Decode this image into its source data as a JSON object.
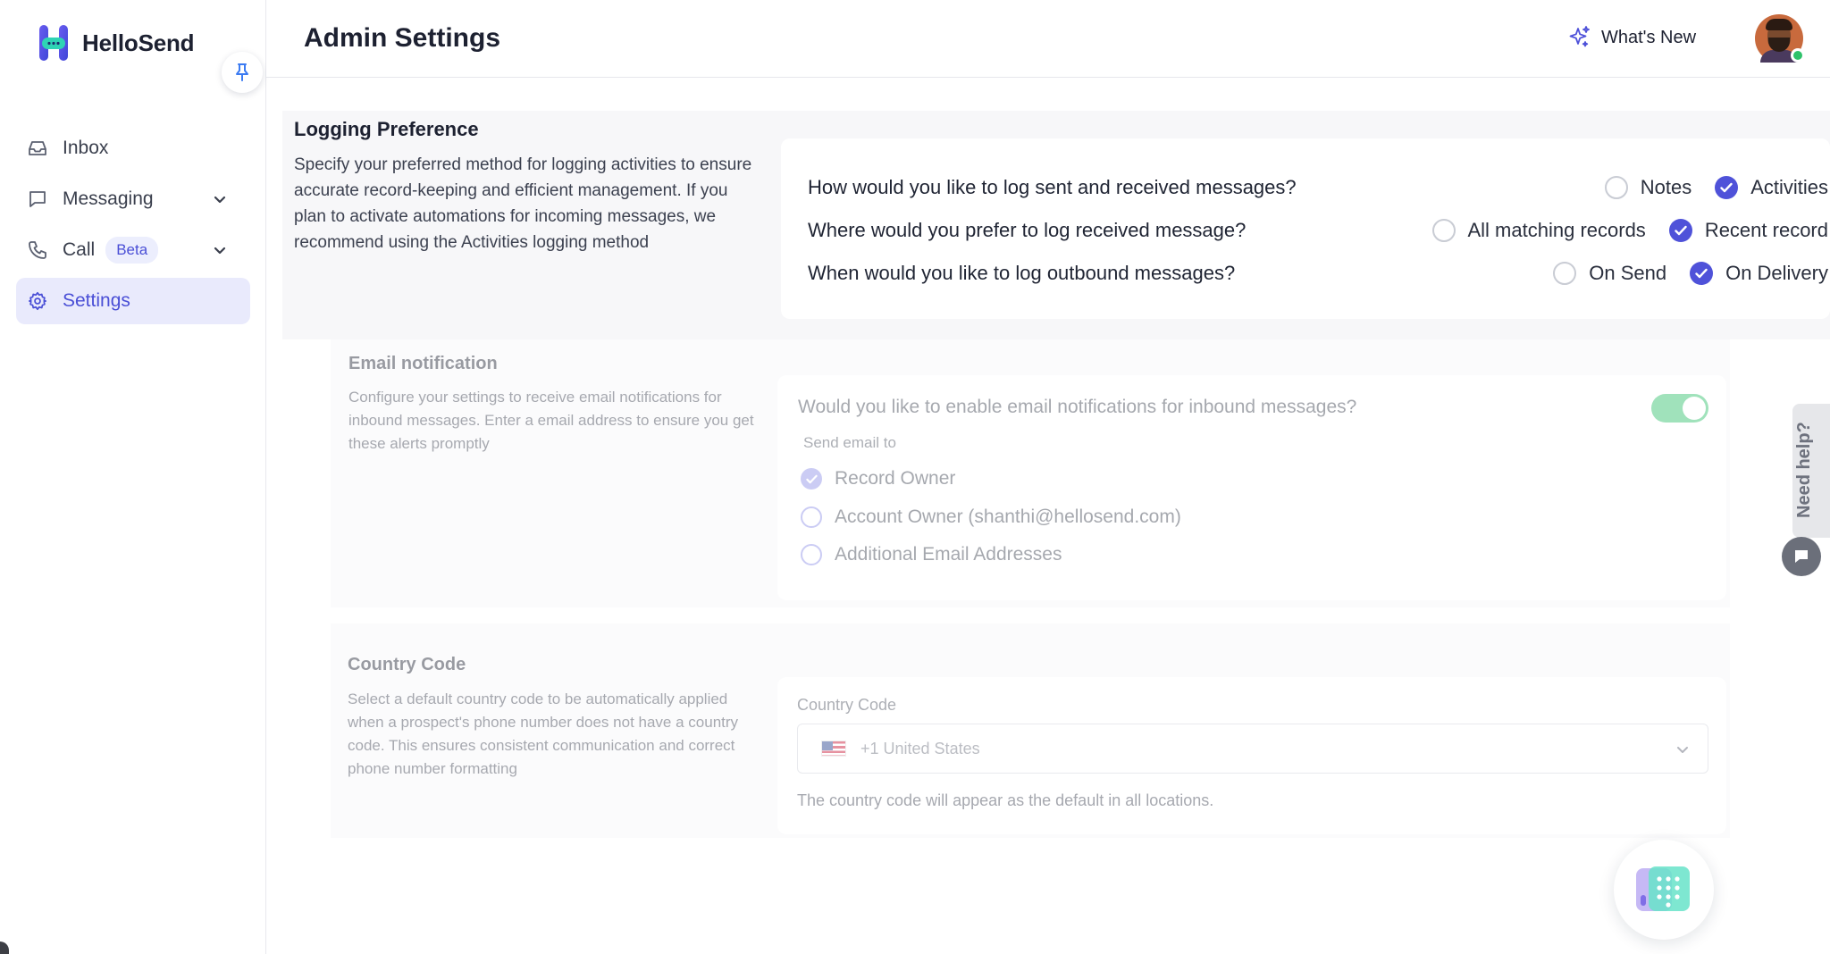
{
  "app": {
    "brand_name": "HelloSend"
  },
  "sidebar": {
    "items": [
      {
        "label": "Inbox"
      },
      {
        "label": "Messaging"
      },
      {
        "label": "Call",
        "badge": "Beta"
      },
      {
        "label": "Settings"
      }
    ],
    "active_item": "Settings"
  },
  "header": {
    "title": "Admin Settings",
    "whats_new": "What's New"
  },
  "logging": {
    "title": "Logging Preference",
    "description": "Specify your preferred method for logging activities to ensure accurate record-keeping and efficient management. If you plan to activate automations for incoming messages, we recommend using the Activities logging method",
    "questions": [
      {
        "text": "How would you like to log sent and received messages?",
        "options": [
          "Notes",
          "Activities"
        ],
        "selected": "Activities"
      },
      {
        "text": "Where would you prefer to log received message?",
        "options": [
          "All matching records",
          "Recent record"
        ],
        "selected": "Recent record"
      },
      {
        "text": "When would you like to log outbound messages?",
        "options": [
          "On Send",
          "On Delivery"
        ],
        "selected": "On Delivery"
      }
    ]
  },
  "email_notification": {
    "title": "Email notification",
    "description": "Configure your settings to receive email notifications for inbound messages. Enter a email address to ensure you get these alerts promptly",
    "question": "Would you like to enable email notifications for inbound messages?",
    "enabled": true,
    "send_to_label": "Send email to",
    "options": [
      "Record Owner",
      "Account Owner (shanthi@hellosend.com)",
      "Additional Email Addresses"
    ],
    "selected": "Record Owner"
  },
  "country_code": {
    "title": "Country Code",
    "description": "Select a default country code to be automatically applied when a prospect's phone number does not have a country code. This ensures consistent communication and correct phone number formatting",
    "field_label": "Country Code",
    "selected_value": "+1 United States",
    "helper_text": "The country code will appear as the default in all locations."
  },
  "help_widget": {
    "label": "Need help?"
  },
  "colors": {
    "accent": "#4f52d9",
    "active_nav_bg": "#e9eafc",
    "toggle_on": "#2fbf6a",
    "online": "#2fc26a"
  },
  "icons": {
    "logo": "hellosend-logo-icon",
    "pin": "pin-icon",
    "inbox": "inbox-icon",
    "messaging": "chat-bubble-icon",
    "call": "phone-icon",
    "settings": "gear-icon",
    "whats_new": "sparkle-icon",
    "chevron": "chevron-down-icon",
    "chat": "chat-icon",
    "dialer": "dialer-icon"
  }
}
